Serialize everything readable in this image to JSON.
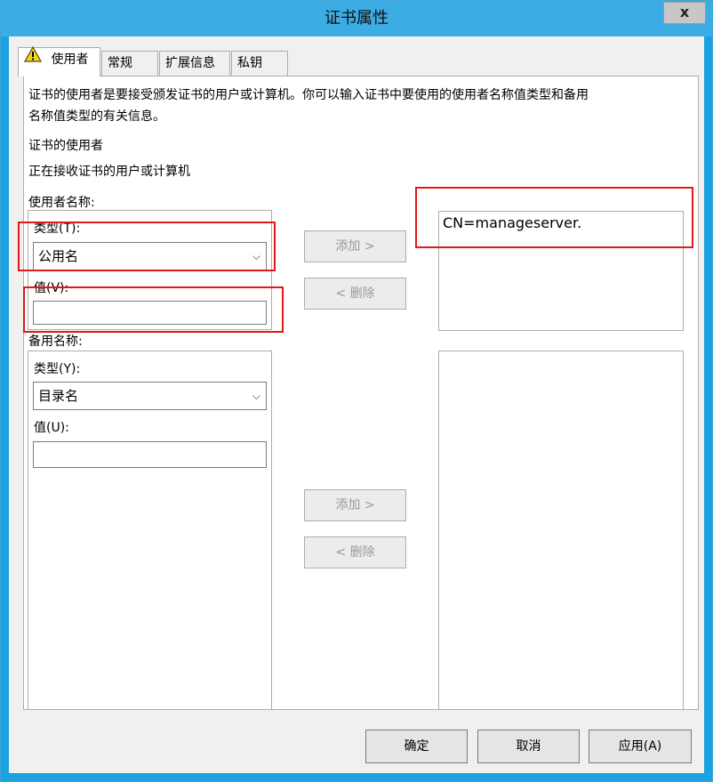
{
  "window": {
    "title": "证书属性",
    "close_label": "x"
  },
  "tabs": [
    {
      "label": "使用者"
    },
    {
      "label": "常规"
    },
    {
      "label": "扩展信息"
    },
    {
      "label": "私钥"
    }
  ],
  "panel": {
    "description": "证书的使用者是要接受颁发证书的用户或计算机。你可以输入证书中要使用的使用者名称值类型和备用名称值类型的有关信息。",
    "description_line1": "证书的使用者是要接受颁发证书的用户或计算机。你可以输入证书中要使用的使用者名称值类型和备用",
    "description_line2": "名称值类型的有关信息。",
    "subject_heading": "证书的使用者",
    "subject_desc": "正在接收证书的用户或计算机",
    "subject_name": {
      "group_label": "使用者名称:",
      "type_label": "类型(T):",
      "type_value": "公用名",
      "value_label": "值(V):",
      "value_input": "",
      "add_label": "添加 >",
      "remove_label": "< 删除",
      "list_items": [
        "CN=manageserver."
      ]
    },
    "alt_name": {
      "group_label": "备用名称:",
      "type_label": "类型(Y):",
      "type_value": "目录名",
      "value_label": "值(U):",
      "value_input": "",
      "add_label": "添加 >",
      "remove_label": "< 删除",
      "list_items": []
    }
  },
  "footer": {
    "ok": "确定",
    "cancel": "取消",
    "apply": "应用(A)"
  },
  "colors": {
    "title_bar": "#3cace4",
    "highlight": "#e01818",
    "panel_bg": "#ffffff"
  },
  "icons": {
    "tab_warning": "warning-icon",
    "dropdown": "chevron-down-icon"
  }
}
